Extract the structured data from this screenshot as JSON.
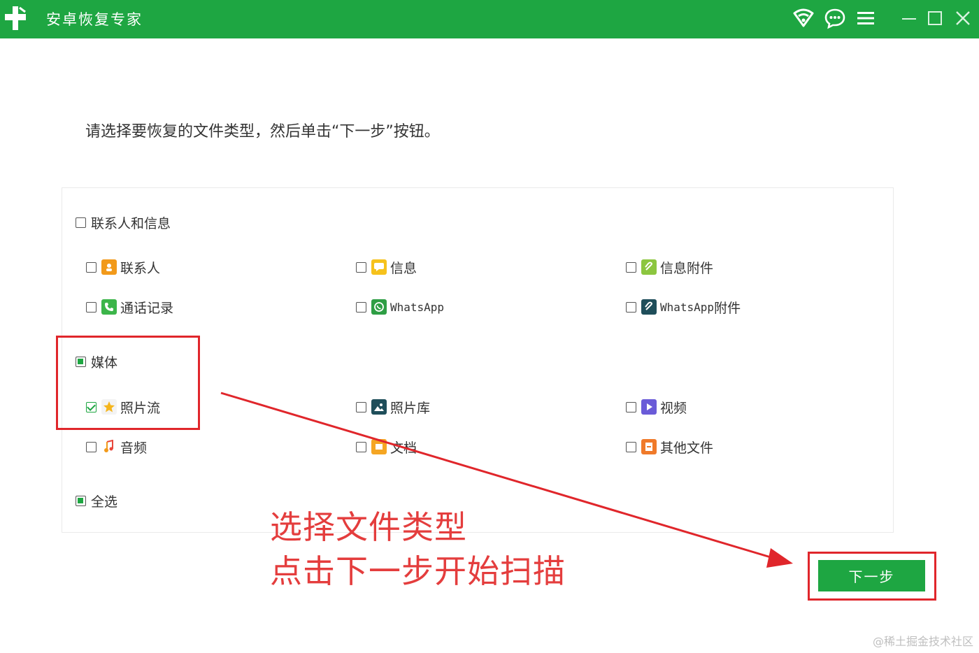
{
  "app": {
    "title": "安卓恢复专家"
  },
  "colors": {
    "brand": "#1ea642",
    "annotation": "#e0262b"
  },
  "instruction": "请选择要恢复的文件类型，然后单击“下一步”按钮。",
  "groups": {
    "contacts": {
      "label": "联系人和信息",
      "state": "unchecked"
    },
    "media": {
      "label": "媒体",
      "state": "partial"
    },
    "select_all": {
      "label": "全选",
      "state": "partial"
    }
  },
  "items": {
    "contacts": {
      "label": "联系人",
      "icon": "contacts-icon",
      "checked": false
    },
    "messages": {
      "label": "信息",
      "icon": "message-icon",
      "checked": false
    },
    "msg_attachments": {
      "label": "信息附件",
      "icon": "attachment-icon",
      "checked": false
    },
    "call_log": {
      "label": "通话记录",
      "icon": "phone-icon",
      "checked": false
    },
    "whatsapp": {
      "label": "WhatsApp",
      "icon": "whatsapp-icon",
      "checked": false
    },
    "whatsapp_attachments": {
      "label": "WhatsApp",
      "label_suffix": "附件",
      "icon": "whatsapp-attachment-icon",
      "checked": false
    },
    "photo_stream": {
      "label": "照片流",
      "icon": "star-icon",
      "checked": true
    },
    "photo_library": {
      "label": "照片库",
      "icon": "image-icon",
      "checked": false
    },
    "video": {
      "label": "视频",
      "icon": "video-icon",
      "checked": false
    },
    "audio": {
      "label": "音频",
      "icon": "music-icon",
      "checked": false
    },
    "documents": {
      "label": "文档",
      "icon": "document-icon",
      "checked": false
    },
    "other_files": {
      "label": "其他文件",
      "icon": "file-icon",
      "checked": false
    }
  },
  "next_button": {
    "label": "下一步"
  },
  "annotation": {
    "line1": "选择文件类型",
    "line2": "点击下一步开始扫描"
  },
  "watermark": "@稀土掘金技术社区"
}
